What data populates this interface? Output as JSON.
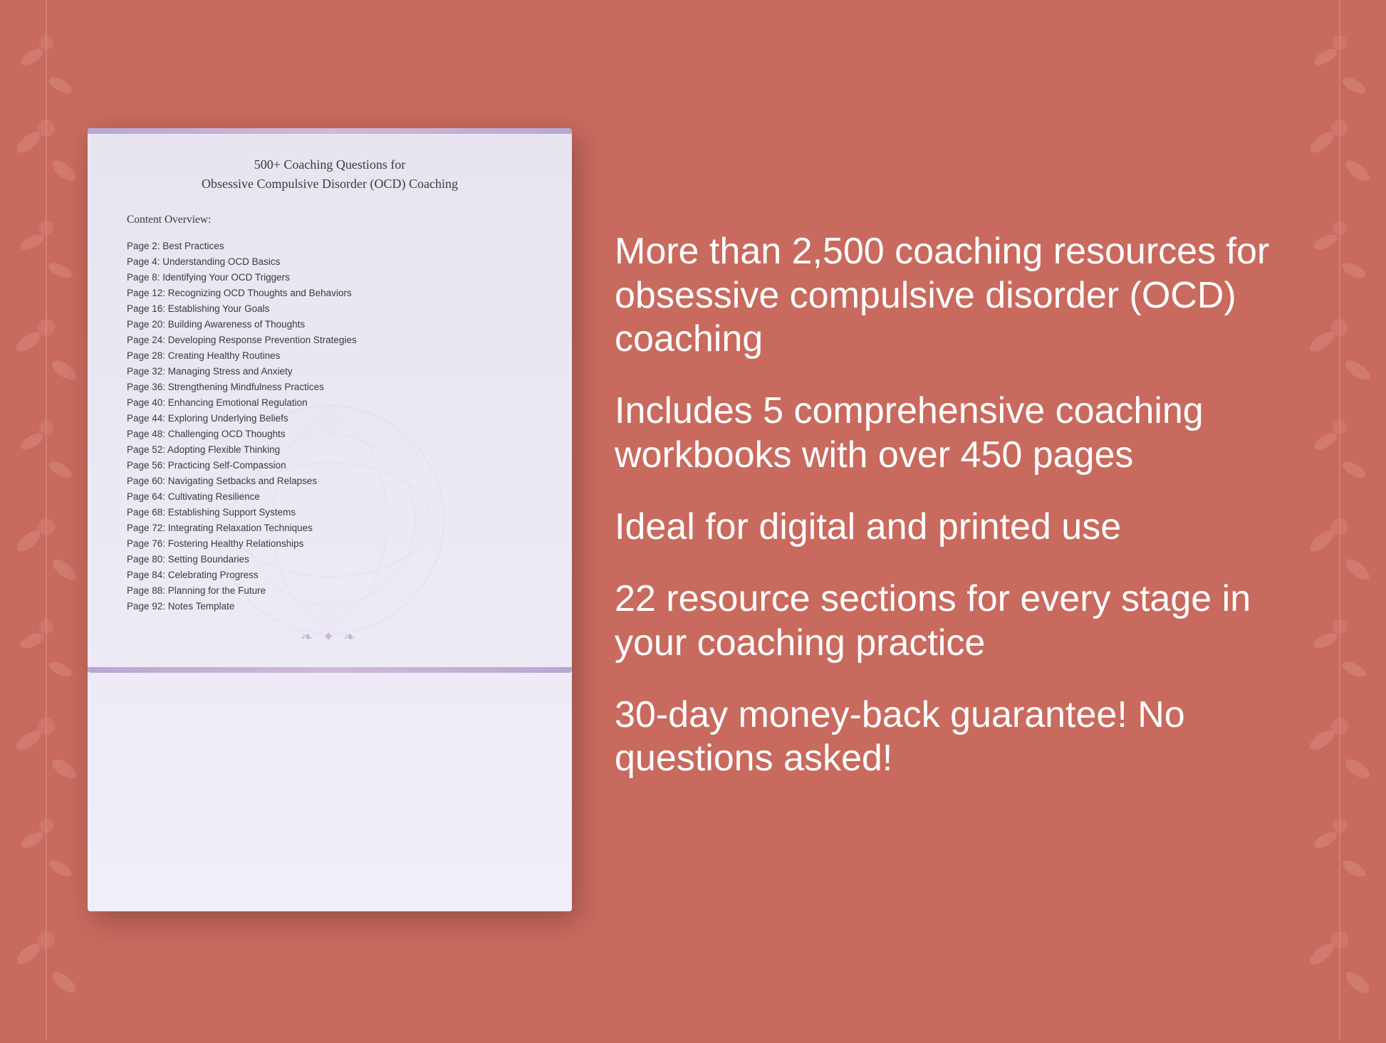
{
  "background": {
    "color": "#c96a5e"
  },
  "document": {
    "title_line1": "500+ Coaching Questions for",
    "title_line2": "Obsessive Compulsive Disorder (OCD) Coaching",
    "content_overview_label": "Content Overview:",
    "toc_items": [
      {
        "page": "Page  2:",
        "topic": "Best Practices"
      },
      {
        "page": "Page  4:",
        "topic": "Understanding OCD Basics"
      },
      {
        "page": "Page  8:",
        "topic": "Identifying Your OCD Triggers"
      },
      {
        "page": "Page 12:",
        "topic": "Recognizing OCD Thoughts and Behaviors"
      },
      {
        "page": "Page 16:",
        "topic": "Establishing Your Goals"
      },
      {
        "page": "Page 20:",
        "topic": "Building Awareness of Thoughts"
      },
      {
        "page": "Page 24:",
        "topic": "Developing Response Prevention Strategies"
      },
      {
        "page": "Page 28:",
        "topic": "Creating Healthy Routines"
      },
      {
        "page": "Page 32:",
        "topic": "Managing Stress and Anxiety"
      },
      {
        "page": "Page 36:",
        "topic": "Strengthening Mindfulness Practices"
      },
      {
        "page": "Page 40:",
        "topic": "Enhancing Emotional Regulation"
      },
      {
        "page": "Page 44:",
        "topic": "Exploring Underlying Beliefs"
      },
      {
        "page": "Page 48:",
        "topic": "Challenging OCD Thoughts"
      },
      {
        "page": "Page 52:",
        "topic": "Adopting Flexible Thinking"
      },
      {
        "page": "Page 56:",
        "topic": "Practicing Self-Compassion"
      },
      {
        "page": "Page 60:",
        "topic": "Navigating Setbacks and Relapses"
      },
      {
        "page": "Page 64:",
        "topic": "Cultivating Resilience"
      },
      {
        "page": "Page 68:",
        "topic": "Establishing Support Systems"
      },
      {
        "page": "Page 72:",
        "topic": "Integrating Relaxation Techniques"
      },
      {
        "page": "Page 76:",
        "topic": "Fostering Healthy Relationships"
      },
      {
        "page": "Page 80:",
        "topic": "Setting Boundaries"
      },
      {
        "page": "Page 84:",
        "topic": "Celebrating Progress"
      },
      {
        "page": "Page 88:",
        "topic": "Planning for the Future"
      },
      {
        "page": "Page 92:",
        "topic": "Notes Template"
      }
    ]
  },
  "features": [
    {
      "id": "feature-1",
      "text": "More than 2,500 coaching resources for obsessive compulsive disorder (OCD) coaching"
    },
    {
      "id": "feature-2",
      "text": "Includes 5 comprehensive coaching workbooks with over 450 pages"
    },
    {
      "id": "feature-3",
      "text": "Ideal for digital and printed use"
    },
    {
      "id": "feature-4",
      "text": "22 resource sections for every stage in your coaching practice"
    },
    {
      "id": "feature-5",
      "text": "30-day money-back guarantee! No questions asked!"
    }
  ]
}
